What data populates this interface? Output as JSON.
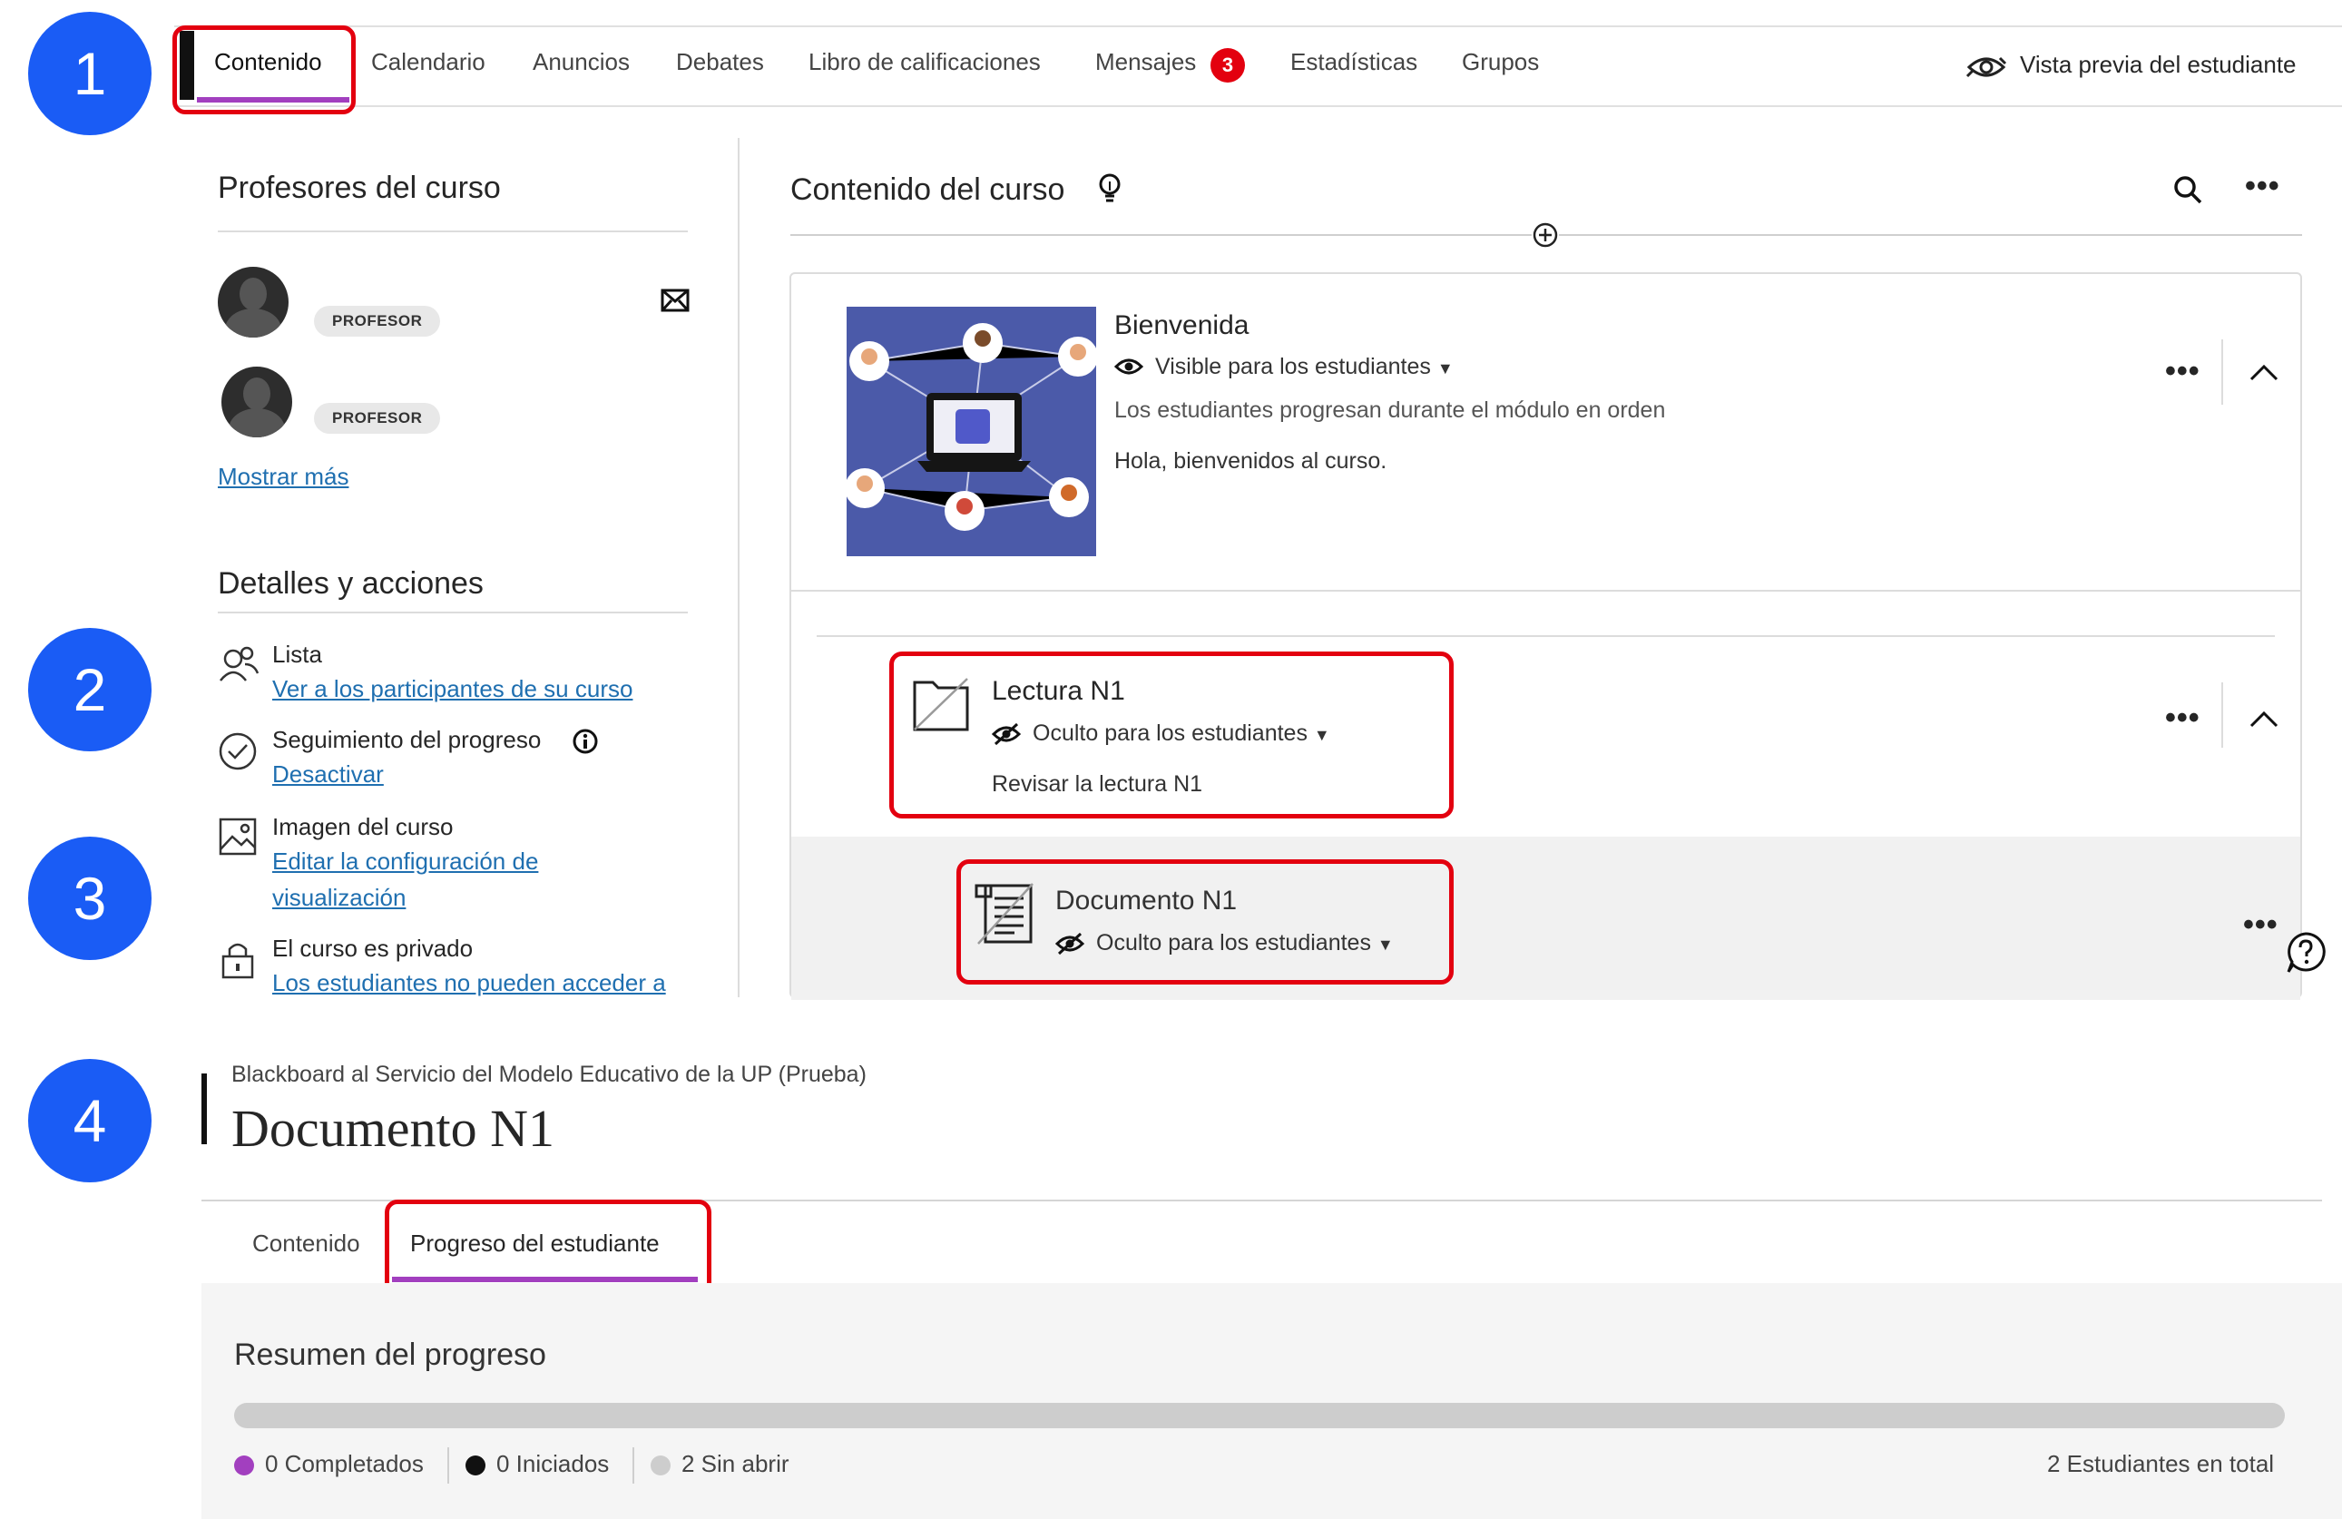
{
  "steps": [
    "1",
    "2",
    "3",
    "4"
  ],
  "nav": {
    "tabs": [
      "Contenido",
      "Calendario",
      "Anuncios",
      "Debates",
      "Libro de calificaciones",
      "Mensajes",
      "Estadísticas",
      "Grupos"
    ],
    "messages_count": "3",
    "student_preview": "Vista previa del estudiante"
  },
  "left": {
    "professors_title": "Profesores del curso",
    "role_label": "PROFESOR",
    "show_more": "Mostrar más",
    "details_title": "Detalles y acciones",
    "roster_label": "Lista",
    "roster_link": "Ver a los participantes de su curso",
    "progress_label": "Seguimiento del progreso",
    "progress_link": "Desactivar",
    "image_label": "Imagen del curso",
    "image_link_1": "Editar la configuración de",
    "image_link_2": "visualización",
    "private_label": "El curso es privado",
    "private_link": "Los estudiantes no pueden acceder a"
  },
  "content": {
    "title": "Contenido del curso",
    "welcome": {
      "title": "Bienvenida",
      "visibility": "Visible para los estudiantes",
      "sequence": "Los estudiantes progresan durante el módulo en orden",
      "description": "Hola, bienvenidos al curso."
    },
    "reading": {
      "title": "Lectura N1",
      "visibility": "Oculto para los estudiantes",
      "description": "Revisar la lectura N1"
    },
    "document": {
      "title": "Documento N1",
      "visibility": "Oculto para los estudiantes"
    }
  },
  "doc_page": {
    "breadcrumb": "Blackboard al Servicio del Modelo Educativo de la UP (Prueba)",
    "title": "Documento N1",
    "tabs": [
      "Contenido",
      "Progreso del estudiante"
    ],
    "summary_title": "Resumen del progreso",
    "completed": "0 Completados",
    "started": "0 Iniciados",
    "not_opened": "2 Sin abrir",
    "total": "2 Estudiantes en total",
    "completed_fraction": 0
  },
  "colors": {
    "step_badge": "#1a5cf5",
    "highlight": "#e3000f",
    "active_tab": "#a23fbf",
    "link": "#1f6fb0"
  }
}
